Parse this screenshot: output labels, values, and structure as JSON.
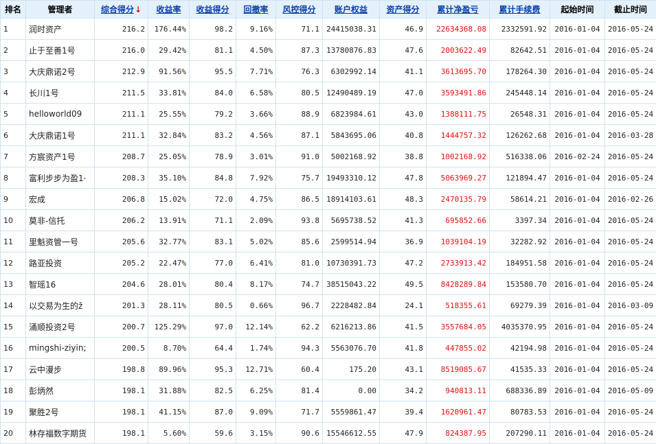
{
  "columns": [
    {
      "label": "排名"
    },
    {
      "label": "管理者"
    },
    {
      "label": "综合得分",
      "sort_icon": "↓"
    },
    {
      "label": "收益率"
    },
    {
      "label": "收益得分"
    },
    {
      "label": "回撤率"
    },
    {
      "label": "风控得分"
    },
    {
      "label": "账户权益"
    },
    {
      "label": "资产得分"
    },
    {
      "label": "累计净盈亏"
    },
    {
      "label": "累计手续费"
    },
    {
      "label": "起始时间"
    },
    {
      "label": "截止时间"
    }
  ],
  "rows": [
    [
      "1",
      "润时资产",
      "216.2",
      "176.44%",
      "98.2",
      "9.16%",
      "71.1",
      "24415038.31",
      "46.9",
      "22634368.08",
      "2332591.92",
      "2016-01-04",
      "2016-05-24"
    ],
    [
      "2",
      "止于至善1号",
      "216.0",
      "29.42%",
      "81.1",
      "4.50%",
      "87.3",
      "13780876.83",
      "47.6",
      "2003622.49",
      "82642.51",
      "2016-01-04",
      "2016-05-24"
    ],
    [
      "3",
      "大庆鼎诺2号",
      "212.9",
      "91.56%",
      "95.5",
      "7.71%",
      "76.3",
      "6302992.14",
      "41.1",
      "3613695.70",
      "178264.30",
      "2016-01-04",
      "2016-05-24"
    ],
    [
      "4",
      "长川1号",
      "211.5",
      "33.81%",
      "84.0",
      "6.58%",
      "80.5",
      "12490489.19",
      "47.0",
      "3593491.86",
      "245448.14",
      "2016-01-04",
      "2016-05-24"
    ],
    [
      "5",
      "helloworld09",
      "211.1",
      "25.55%",
      "79.2",
      "3.66%",
      "88.9",
      "6823984.61",
      "43.0",
      "1388111.75",
      "26548.31",
      "2016-01-04",
      "2016-05-24"
    ],
    [
      "6",
      "大庆鼎诺1号",
      "211.1",
      "32.84%",
      "83.2",
      "4.56%",
      "87.1",
      "5843695.06",
      "40.8",
      "1444757.32",
      "126262.68",
      "2016-01-04",
      "2016-03-28"
    ],
    [
      "7",
      "方宸资产1号",
      "208.7",
      "25.05%",
      "78.9",
      "3.01%",
      "91.0",
      "5002168.92",
      "38.8",
      "1002168.92",
      "516338.06",
      "2016-02-24",
      "2016-05-24"
    ],
    [
      "8",
      "富利步步为盈1·",
      "208.3",
      "35.10%",
      "84.8",
      "7.92%",
      "75.7",
      "19493310.12",
      "47.8",
      "5063969.27",
      "121894.47",
      "2016-01-04",
      "2016-05-24"
    ],
    [
      "9",
      "宏成",
      "206.8",
      "15.02%",
      "72.0",
      "4.75%",
      "86.5",
      "18914103.61",
      "48.3",
      "2470135.79",
      "58614.21",
      "2016-01-04",
      "2016-02-26"
    ],
    [
      "10",
      "莫非-信托",
      "206.2",
      "13.91%",
      "71.1",
      "2.09%",
      "93.8",
      "5695738.52",
      "41.3",
      "695852.66",
      "3397.34",
      "2016-01-04",
      "2016-05-24"
    ],
    [
      "11",
      "里魁资管一号",
      "205.6",
      "32.77%",
      "83.1",
      "5.02%",
      "85.6",
      "2599514.94",
      "36.9",
      "1039104.19",
      "32282.92",
      "2016-01-04",
      "2016-05-24"
    ],
    [
      "12",
      "路亚投资",
      "205.2",
      "22.47%",
      "77.0",
      "6.41%",
      "81.0",
      "10730391.73",
      "47.2",
      "2733913.42",
      "184951.58",
      "2016-01-04",
      "2016-05-24"
    ],
    [
      "13",
      "智瑶16",
      "204.6",
      "28.01%",
      "80.4",
      "8.17%",
      "74.7",
      "38515043.22",
      "49.5",
      "8428289.84",
      "153580.70",
      "2016-01-04",
      "2016-05-24"
    ],
    [
      "14",
      "以交易为生的ž",
      "201.3",
      "28.11%",
      "80.5",
      "0.66%",
      "96.7",
      "2228482.84",
      "24.1",
      "518355.61",
      "69279.39",
      "2016-01-04",
      "2016-03-09"
    ],
    [
      "15",
      "涌顺投资2号",
      "200.7",
      "125.29%",
      "97.0",
      "12.14%",
      "62.2",
      "6216213.86",
      "41.5",
      "3557684.05",
      "4035370.95",
      "2016-01-04",
      "2016-05-24"
    ],
    [
      "16",
      "mingshi-ziyin;",
      "200.5",
      "8.70%",
      "64.4",
      "1.74%",
      "94.3",
      "5563076.70",
      "41.8",
      "447855.02",
      "42194.98",
      "2016-01-04",
      "2016-05-24"
    ],
    [
      "17",
      "云中漫步",
      "198.8",
      "89.96%",
      "95.3",
      "12.71%",
      "60.4",
      "175.20",
      "43.1",
      "8519085.67",
      "41535.33",
      "2016-01-04",
      "2016-05-24"
    ],
    [
      "18",
      "彭炳然",
      "198.1",
      "31.88%",
      "82.5",
      "6.25%",
      "81.4",
      "0.00",
      "34.2",
      "940813.11",
      "688336.89",
      "2016-01-04",
      "2016-05-09"
    ],
    [
      "19",
      "聚胜2号",
      "198.1",
      "41.15%",
      "87.0",
      "9.09%",
      "71.7",
      "5559861.47",
      "39.4",
      "1620961.47",
      "80783.53",
      "2016-01-04",
      "2016-05-24"
    ],
    [
      "20",
      "林存福数字期货",
      "198.1",
      "5.60%",
      "59.6",
      "3.15%",
      "90.6",
      "15546612.55",
      "47.9",
      "824387.95",
      "207290.11",
      "2016-01-04",
      "2016-05-24"
    ]
  ],
  "colors": {
    "header_bg": "#e4f1fb",
    "link": "#0b3ea8",
    "profit": "#e01010",
    "border": "#cfe3f2"
  }
}
